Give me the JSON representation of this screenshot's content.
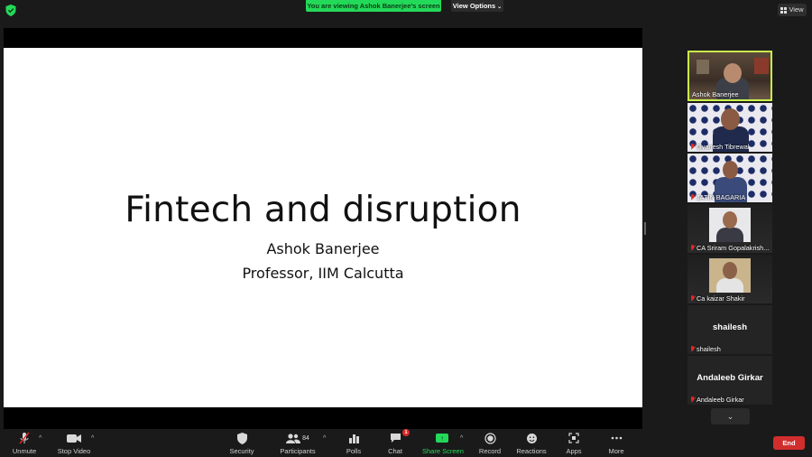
{
  "top_bar": {
    "share_banner": "You are viewing Ashok Banerjee's screen",
    "view_options_label": "View Options",
    "view_label": "View"
  },
  "slide": {
    "title": "Fintech and disruption",
    "author": "Ashok Banerjee",
    "role": "Professor, IIM Calcutta"
  },
  "participants": [
    {
      "name": "Ashok Banerjee",
      "muted": false,
      "active": true,
      "video": true
    },
    {
      "name": "Gyanesh Tibrewal",
      "muted": true,
      "active": false,
      "video": true
    },
    {
      "name": "JATIN BAGARIA",
      "muted": true,
      "active": false,
      "video": true
    },
    {
      "name": "CA Sriram Gopalakrish...",
      "muted": true,
      "active": false,
      "video": true
    },
    {
      "name": "Ca kaizar Shakir",
      "muted": true,
      "active": false,
      "video": true
    },
    {
      "name": "shailesh",
      "display_name": "shailesh",
      "muted": true,
      "active": false,
      "video": false
    },
    {
      "name": "Andaleeb Girkar",
      "display_name": "Andaleeb Girkar",
      "muted": true,
      "active": false,
      "video": false
    }
  ],
  "toolbar": {
    "unmute": "Unmute",
    "stop_video": "Stop Video",
    "security": "Security",
    "participants": "Participants",
    "participants_count": "84",
    "polls": "Polls",
    "chat": "Chat",
    "chat_badge": "1",
    "share_screen": "Share Screen",
    "record": "Record",
    "reactions": "Reactions",
    "apps": "Apps",
    "more": "More",
    "end": "End"
  },
  "colors": {
    "share_green": "#23d959",
    "active_speaker_border": "#c9f04b",
    "end_red": "#d12d2d",
    "muted_red": "#e02828"
  }
}
